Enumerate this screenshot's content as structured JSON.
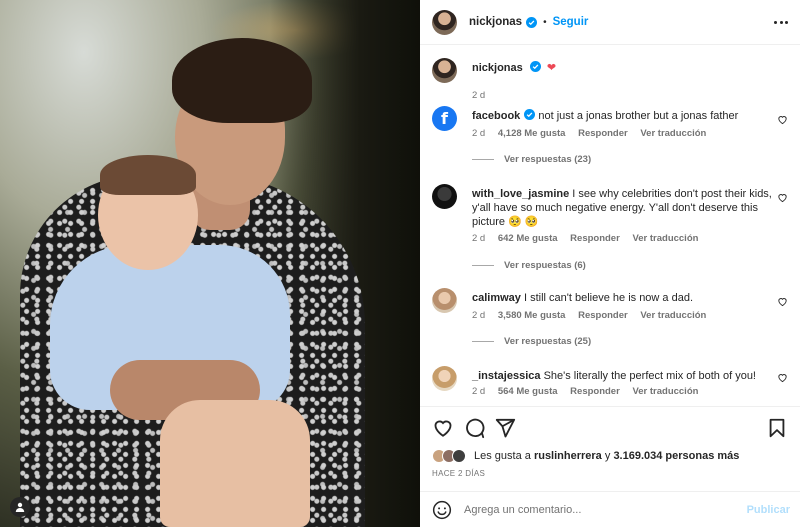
{
  "post": {
    "username": "nickjonas",
    "follow_label": "Seguir",
    "dot": "•",
    "caption_emoji": "❤",
    "caption_time": "2 d"
  },
  "comments": [
    {
      "user": "facebook",
      "text": "not just a jonas brother but a jonas father",
      "time": "2 d",
      "likes": "4,128 Me gusta",
      "reply": "Responder",
      "translate": "Ver traducción",
      "replies": "Ver respuestas (23)",
      "verified": true
    },
    {
      "user": "with_love_jasmine",
      "text": "I see why celebrities don't post their kids, y'all have so much negative energy. Y'all don't deserve this picture 🥺 🥺",
      "time": "2 d",
      "likes": "642 Me gusta",
      "reply": "Responder",
      "translate": "Ver traducción",
      "replies": "Ver respuestas (6)"
    },
    {
      "user": "calimway",
      "text": "I still can't believe he is now a dad.",
      "time": "2 d",
      "likes": "3,580 Me gusta",
      "reply": "Responder",
      "translate": "Ver traducción",
      "replies": "Ver respuestas (25)"
    },
    {
      "user": "_instajessica",
      "text": "She's literally the perfect mix of both of you!",
      "time": "2 d",
      "likes": "564 Me gusta",
      "reply": "Responder",
      "translate": "Ver traducción"
    }
  ],
  "likes_line": {
    "prefix": "Les gusta a",
    "user": "ruslinherrera",
    "connector": "y",
    "others": "3.169.034 personas más"
  },
  "time_ago": "HACE 2 DÍAS",
  "comment_input": {
    "placeholder": "Agrega un comentario...",
    "publish_label": "Publicar"
  },
  "colors": {
    "accent": "#0095f6",
    "verified": "#0095f6",
    "heart": "#ed4956",
    "facebook": "#1877f2",
    "publish_disabled": "#b2dffc"
  },
  "icons": {
    "media_user": "user-tag-icon",
    "like": "heart-icon",
    "comment": "comment-icon",
    "share": "paper-plane-icon",
    "save": "bookmark-icon",
    "emoji": "smiley-icon",
    "more": "more-options-icon"
  }
}
